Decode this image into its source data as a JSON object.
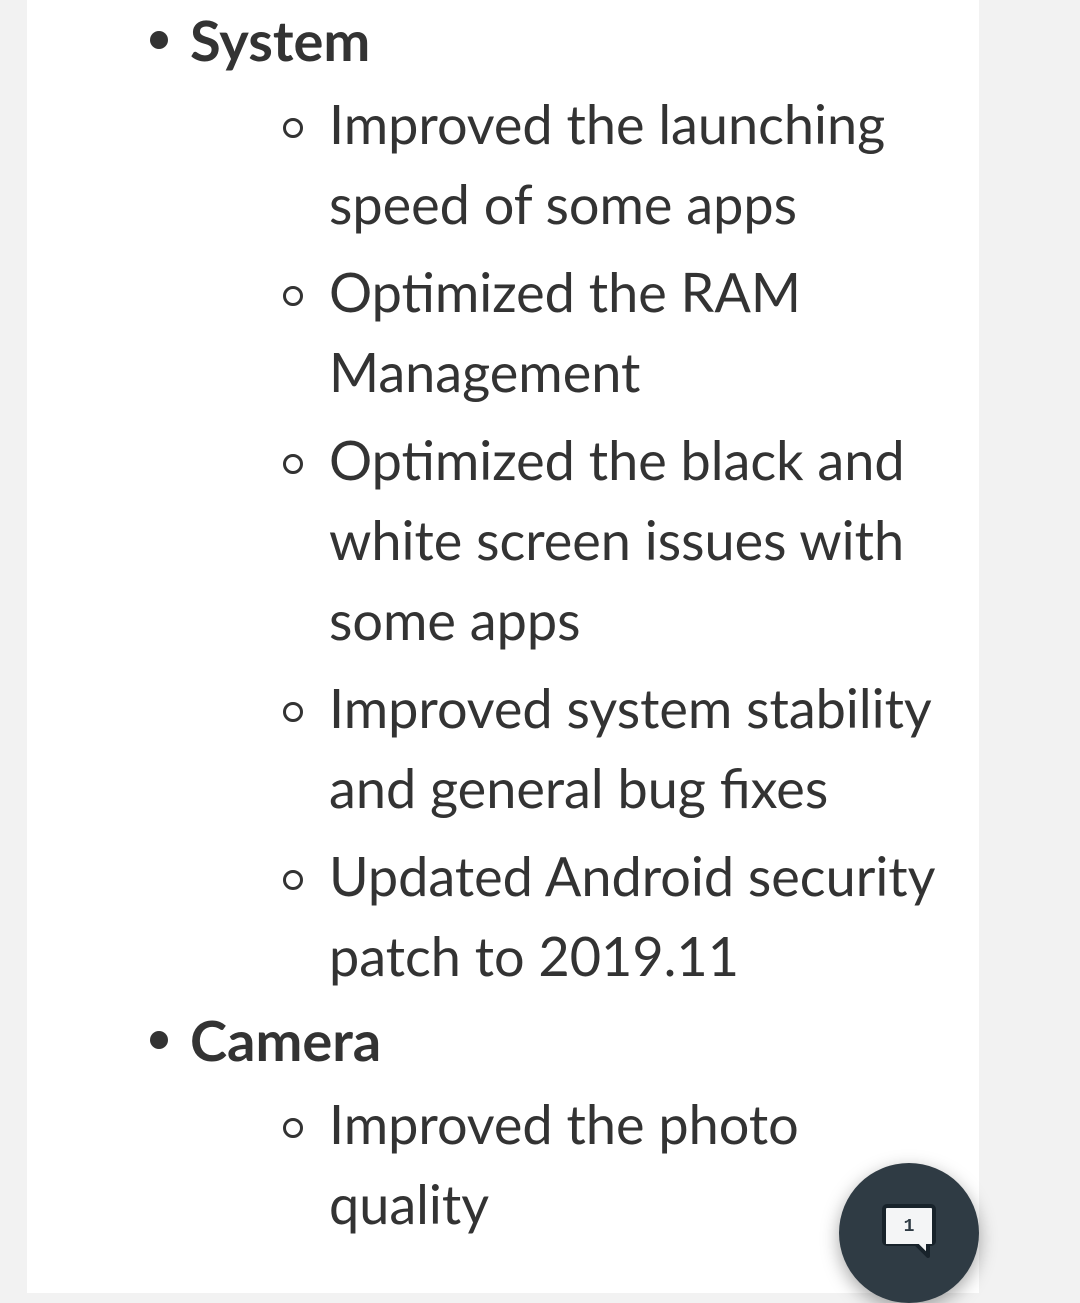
{
  "changelog": {
    "sections": [
      {
        "title": "System",
        "items": [
          "Improved the launching speed of some apps",
          "Optimized the RAM Management",
          "Optimized the black and white screen issues with some apps",
          "Improved system stability and general bug fixes",
          "Updated Android security patch to 2019.11"
        ]
      },
      {
        "title": "Camera",
        "items": [
          "Improved the photo quality"
        ]
      }
    ]
  },
  "fab": {
    "badge": "1"
  }
}
